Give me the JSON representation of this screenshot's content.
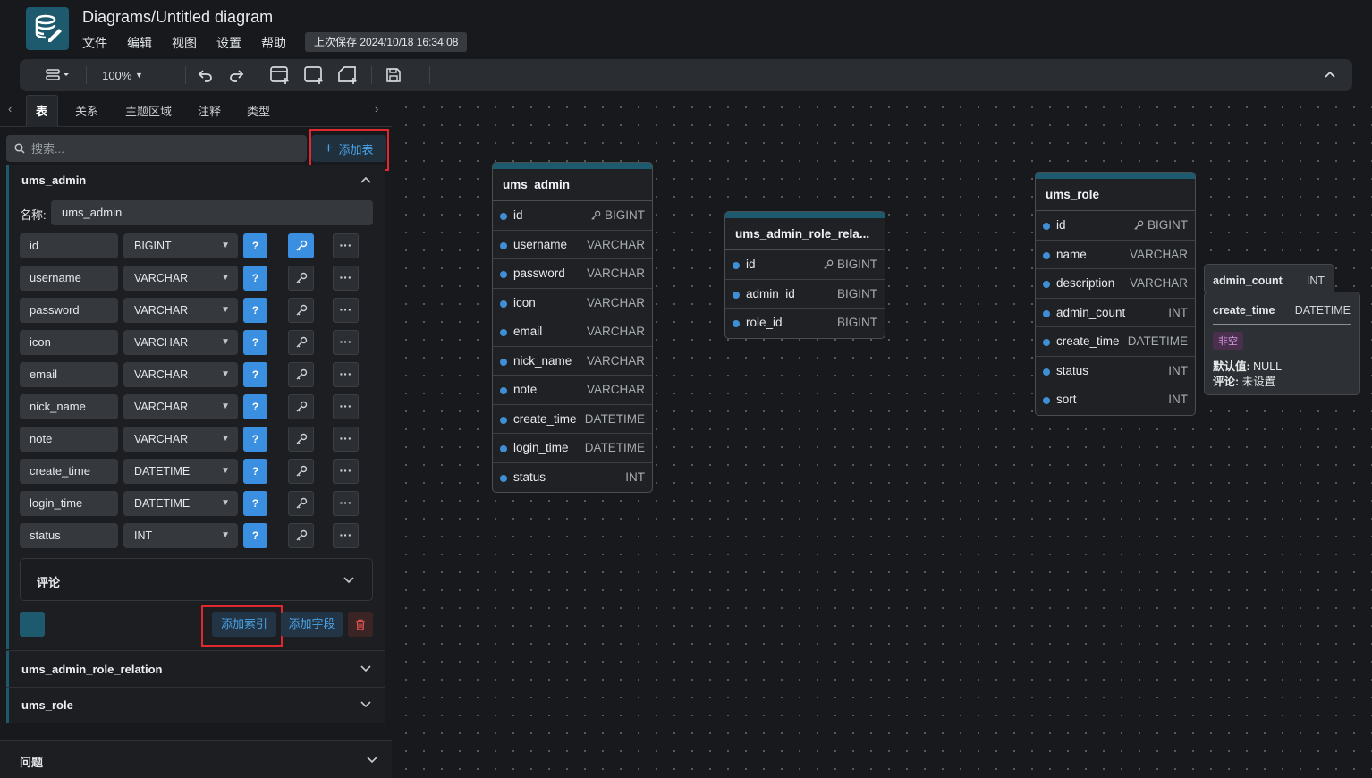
{
  "header": {
    "title": "Diagrams/Untitled diagram",
    "menu": [
      "文件",
      "编辑",
      "视图",
      "设置",
      "帮助"
    ],
    "last_saved": "上次保存 2024/10/18 16:34:08"
  },
  "toolbar": {
    "zoom": "100%"
  },
  "sidebar": {
    "tabs": [
      "表",
      "关系",
      "主题区域",
      "注释",
      "类型"
    ],
    "search_placeholder": "搜索...",
    "add_table": "添加表",
    "expanded_table": {
      "title": "ums_admin",
      "name_label": "名称:",
      "name_value": "ums_admin",
      "fields": [
        {
          "name": "id",
          "type": "BIGINT"
        },
        {
          "name": "username",
          "type": "VARCHAR"
        },
        {
          "name": "password",
          "type": "VARCHAR"
        },
        {
          "name": "icon",
          "type": "VARCHAR"
        },
        {
          "name": "email",
          "type": "VARCHAR"
        },
        {
          "name": "nick_name",
          "type": "VARCHAR"
        },
        {
          "name": "note",
          "type": "VARCHAR"
        },
        {
          "name": "create_time",
          "type": "DATETIME"
        },
        {
          "name": "login_time",
          "type": "DATETIME"
        },
        {
          "name": "status",
          "type": "INT"
        }
      ],
      "q_label": "?",
      "comment_label": "评论",
      "add_index": "添加索引",
      "add_field": "添加字段"
    },
    "collapsed_tables": [
      "ums_admin_role_relation",
      "ums_role"
    ],
    "issues_label": "问题"
  },
  "canvas": {
    "tables": [
      {
        "name": "ums_admin",
        "fields": [
          {
            "name": "id",
            "type": "BIGINT",
            "pk": true
          },
          {
            "name": "username",
            "type": "VARCHAR"
          },
          {
            "name": "password",
            "type": "VARCHAR"
          },
          {
            "name": "icon",
            "type": "VARCHAR"
          },
          {
            "name": "email",
            "type": "VARCHAR"
          },
          {
            "name": "nick_name",
            "type": "VARCHAR"
          },
          {
            "name": "note",
            "type": "VARCHAR"
          },
          {
            "name": "create_time",
            "type": "DATETIME"
          },
          {
            "name": "login_time",
            "type": "DATETIME"
          },
          {
            "name": "status",
            "type": "INT"
          }
        ]
      },
      {
        "name": "ums_admin_role_rela...",
        "fields": [
          {
            "name": "id",
            "type": "BIGINT",
            "pk": true
          },
          {
            "name": "admin_id",
            "type": "BIGINT"
          },
          {
            "name": "role_id",
            "type": "BIGINT"
          }
        ]
      },
      {
        "name": "ums_role",
        "fields": [
          {
            "name": "id",
            "type": "BIGINT",
            "pk": true
          },
          {
            "name": "name",
            "type": "VARCHAR"
          },
          {
            "name": "description",
            "type": "VARCHAR"
          },
          {
            "name": "admin_count",
            "type": "INT"
          },
          {
            "name": "create_time",
            "type": "DATETIME"
          },
          {
            "name": "status",
            "type": "INT"
          },
          {
            "name": "sort",
            "type": "INT"
          }
        ]
      }
    ],
    "tooltip_back": {
      "name": "admin_count",
      "type": "INT"
    },
    "tooltip": {
      "name": "create_time",
      "type": "DATETIME",
      "badge": "非空",
      "default_label": "默认值:",
      "default_value": "NULL",
      "comment_label": "评论:",
      "comment_value": "未设置"
    }
  },
  "colors": {
    "accent": "#1d5a6e",
    "blue": "#3b8fe0",
    "highlight": "#e0282e"
  }
}
